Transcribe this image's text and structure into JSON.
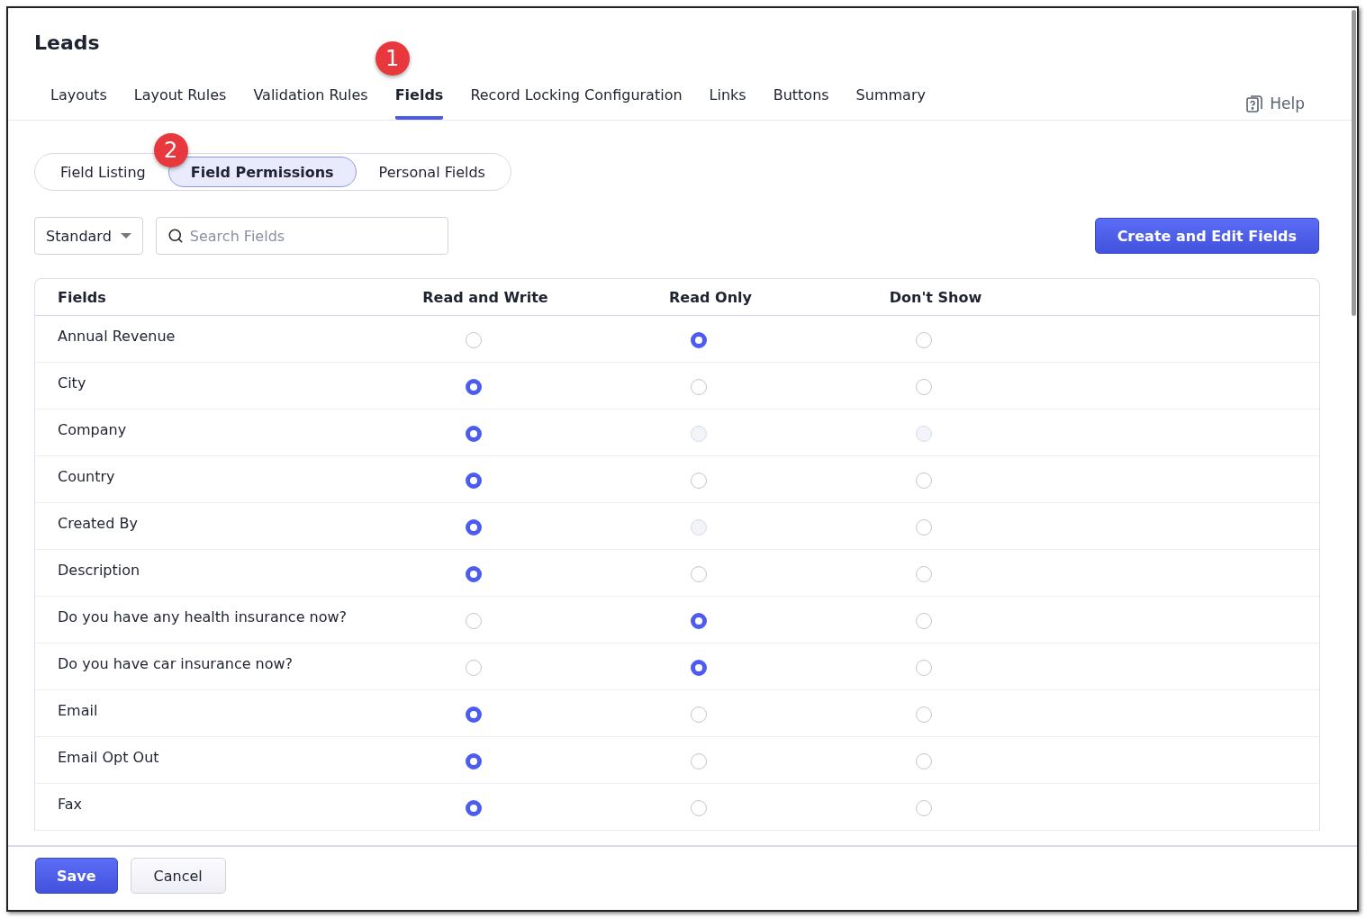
{
  "page": {
    "title": "Leads"
  },
  "tabs": [
    {
      "label": "Layouts",
      "selected": false
    },
    {
      "label": "Layout Rules",
      "selected": false
    },
    {
      "label": "Validation Rules",
      "selected": false
    },
    {
      "label": "Fields",
      "selected": true,
      "callout": "1"
    },
    {
      "label": "Record Locking Configuration",
      "selected": false
    },
    {
      "label": "Links",
      "selected": false
    },
    {
      "label": "Buttons",
      "selected": false
    },
    {
      "label": "Summary",
      "selected": false
    }
  ],
  "help": {
    "label": "Help"
  },
  "subtabs": [
    {
      "label": "Field Listing",
      "selected": false
    },
    {
      "label": "Field Permissions",
      "selected": true,
      "callout": "2"
    },
    {
      "label": "Personal Fields",
      "selected": false
    }
  ],
  "toolbar": {
    "filter": "Standard",
    "search": {
      "placeholder": "Search Fields"
    },
    "create_button": "Create and Edit Fields"
  },
  "table": {
    "columns": [
      "Fields",
      "Read and Write",
      "Read Only",
      "Don't Show"
    ],
    "rows": [
      {
        "name": "Annual Revenue",
        "options": [
          {
            "selected": false,
            "disabled": false
          },
          {
            "selected": true,
            "disabled": false
          },
          {
            "selected": false,
            "disabled": false
          }
        ]
      },
      {
        "name": "City",
        "options": [
          {
            "selected": true,
            "disabled": false
          },
          {
            "selected": false,
            "disabled": false
          },
          {
            "selected": false,
            "disabled": false
          }
        ]
      },
      {
        "name": "Company",
        "options": [
          {
            "selected": true,
            "disabled": false
          },
          {
            "selected": false,
            "disabled": true
          },
          {
            "selected": false,
            "disabled": true
          }
        ]
      },
      {
        "name": "Country",
        "options": [
          {
            "selected": true,
            "disabled": false
          },
          {
            "selected": false,
            "disabled": false
          },
          {
            "selected": false,
            "disabled": false
          }
        ]
      },
      {
        "name": "Created By",
        "options": [
          {
            "selected": true,
            "disabled": false
          },
          {
            "selected": false,
            "disabled": true
          },
          {
            "selected": false,
            "disabled": false
          }
        ]
      },
      {
        "name": "Description",
        "options": [
          {
            "selected": true,
            "disabled": false
          },
          {
            "selected": false,
            "disabled": false
          },
          {
            "selected": false,
            "disabled": false
          }
        ]
      },
      {
        "name": "Do you have any health insurance now?",
        "options": [
          {
            "selected": false,
            "disabled": false
          },
          {
            "selected": true,
            "disabled": false
          },
          {
            "selected": false,
            "disabled": false
          }
        ]
      },
      {
        "name": "Do you have car insurance now?",
        "options": [
          {
            "selected": false,
            "disabled": false
          },
          {
            "selected": true,
            "disabled": false
          },
          {
            "selected": false,
            "disabled": false
          }
        ]
      },
      {
        "name": "Email",
        "options": [
          {
            "selected": true,
            "disabled": false
          },
          {
            "selected": false,
            "disabled": false
          },
          {
            "selected": false,
            "disabled": false
          }
        ]
      },
      {
        "name": "Email Opt Out",
        "options": [
          {
            "selected": true,
            "disabled": false
          },
          {
            "selected": false,
            "disabled": false
          },
          {
            "selected": false,
            "disabled": false
          }
        ]
      },
      {
        "name": "Fax",
        "options": [
          {
            "selected": true,
            "disabled": false
          },
          {
            "selected": false,
            "disabled": false
          },
          {
            "selected": false,
            "disabled": false
          }
        ]
      }
    ]
  },
  "footer": {
    "save": "Save",
    "cancel": "Cancel"
  }
}
